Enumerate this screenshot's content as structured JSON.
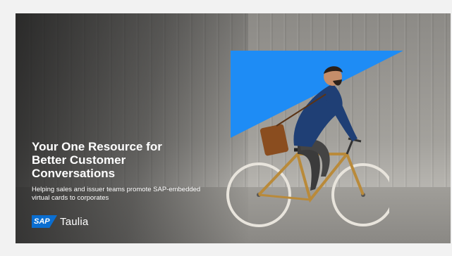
{
  "banner": {
    "headline": "Your One Resource for Better Customer Conversations",
    "subtitle": "Helping sales and issuer teams promote SAP-embedded virtual cards to corporates",
    "logo": {
      "sap": "SAP",
      "brand": "Taulia"
    }
  },
  "icons": [
    "sap-logo-icon"
  ],
  "colors": {
    "accent": "#1e8cf5",
    "sap_blue": "#0a6ed1",
    "text": "#ffffff"
  }
}
